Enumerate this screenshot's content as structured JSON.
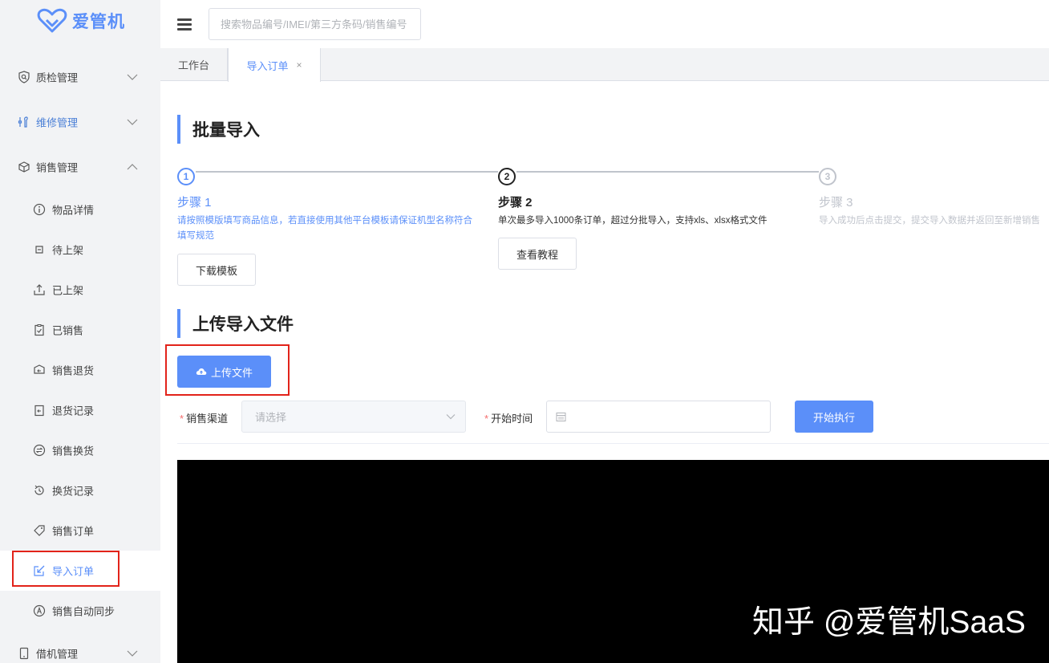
{
  "brand": {
    "logo_text": "爱管机",
    "color": "#5b8ff9"
  },
  "header": {
    "search_placeholder": "搜索物品编号/IMEI/第三方条码/销售编号"
  },
  "tabs": [
    {
      "label": "工作台"
    },
    {
      "label": "导入订单",
      "close": "×"
    }
  ],
  "sidebar": {
    "groups": [
      {
        "label": "质检管理",
        "icon": "shield-search-icon"
      },
      {
        "label": "维修管理",
        "icon": "wrench-icon"
      },
      {
        "label": "销售管理",
        "icon": "box-icon"
      },
      {
        "label": "借机管理",
        "icon": "phone-icon"
      }
    ],
    "sales_items": [
      {
        "label": "物品详情",
        "icon": "info-icon"
      },
      {
        "label": "待上架",
        "icon": "pending-shelf-icon"
      },
      {
        "label": "已上架",
        "icon": "upload-icon"
      },
      {
        "label": "已销售",
        "icon": "clipboard-check-icon"
      },
      {
        "label": "销售退货",
        "icon": "return-icon"
      },
      {
        "label": "退货记录",
        "icon": "return-record-icon"
      },
      {
        "label": "销售换货",
        "icon": "exchange-icon"
      },
      {
        "label": "换货记录",
        "icon": "history-icon"
      },
      {
        "label": "销售订单",
        "icon": "tag-icon"
      },
      {
        "label": "导入订单",
        "icon": "edit-import-icon"
      },
      {
        "label": "销售自动同步",
        "icon": "auto-sync-icon"
      }
    ]
  },
  "main": {
    "batch_title": "批量导入",
    "steps": [
      {
        "num": "1",
        "title": "步骤 1",
        "desc": "请按照模版填写商品信息，若直接使用其他平台模板请保证机型名称符合填写规范",
        "button": "下载模板"
      },
      {
        "num": "2",
        "title": "步骤 2",
        "desc": "单次最多导入1000条订单，超过分批导入，支持xls、xlsx格式文件",
        "button": "查看教程"
      },
      {
        "num": "3",
        "title": "步骤 3",
        "desc": "导入成功后点击提交，提交导入数据并返回至新增销售"
      }
    ],
    "upload_title": "上传导入文件",
    "upload_button": "上传文件",
    "form": {
      "channel_label": "销售渠道",
      "channel_placeholder": "请选择",
      "start_time_label": "开始时间",
      "required_mark": "*",
      "execute_button": "开始执行"
    },
    "watermark": "知乎 @爱管机SaaS"
  }
}
